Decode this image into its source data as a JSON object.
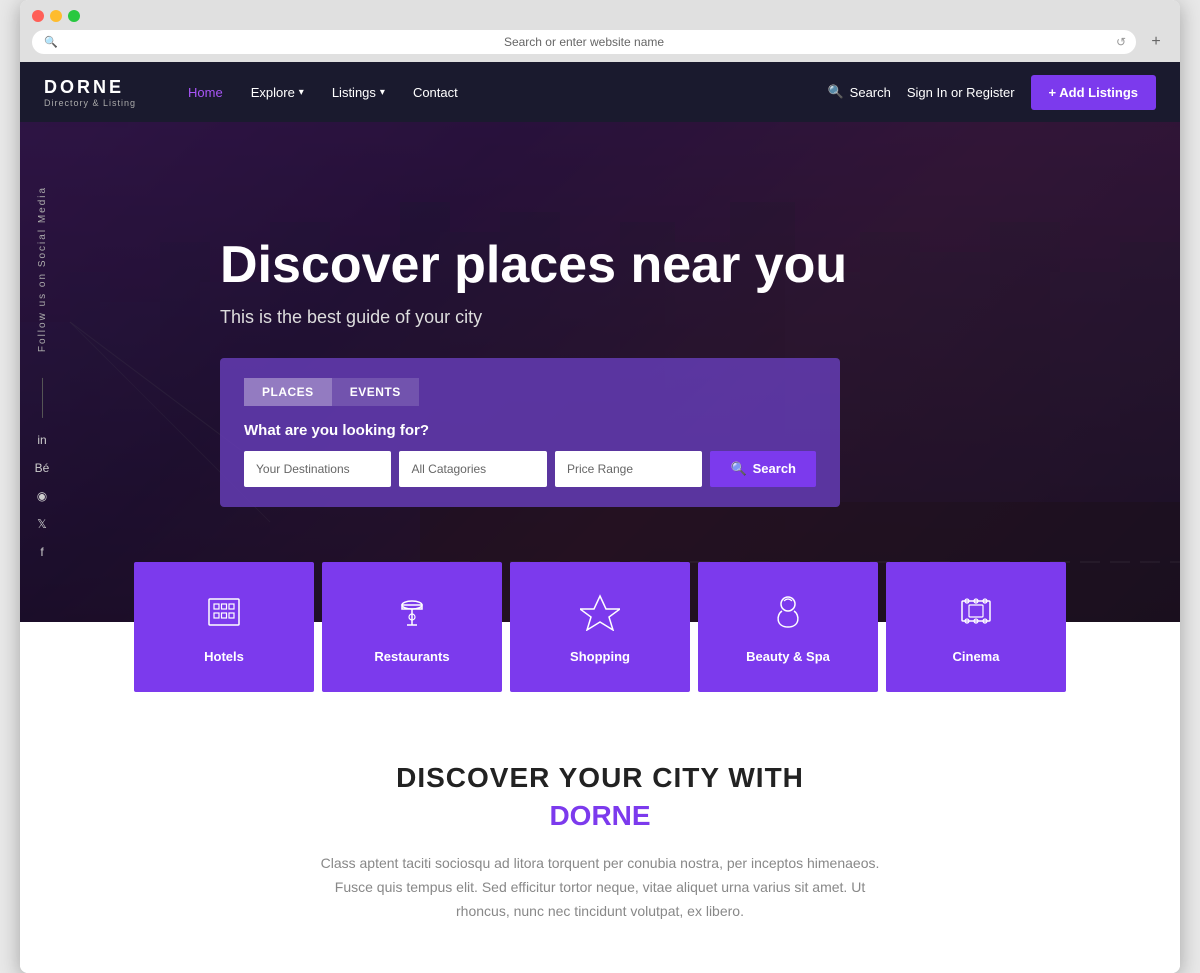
{
  "browser": {
    "address_bar_text": "Search or enter website name",
    "new_tab_label": "+"
  },
  "navbar": {
    "logo_name": "DORNE",
    "logo_subtitle": "Directory & Listing",
    "nav_links": [
      {
        "label": "Home",
        "active": true,
        "has_arrow": false
      },
      {
        "label": "Explore",
        "active": false,
        "has_arrow": true
      },
      {
        "label": "Listings",
        "active": false,
        "has_arrow": true
      },
      {
        "label": "Contact",
        "active": false,
        "has_arrow": false
      }
    ],
    "search_label": "Search",
    "sign_in_label": "Sign In or Register",
    "add_listings_label": "+ Add Listings"
  },
  "hero": {
    "title": "Discover places near you",
    "subtitle": "This is the best guide of your city",
    "search_box": {
      "tabs": [
        {
          "label": "PLACES",
          "active": true
        },
        {
          "label": "EVENTS",
          "active": false
        }
      ],
      "question": "What are you looking for?",
      "destination_placeholder": "Your Destinations",
      "category_placeholder": "All Catagories",
      "price_placeholder": "Price Range",
      "search_button": "Search"
    },
    "social_sidebar": {
      "label": "Follow us on Social Media",
      "icons": [
        "in",
        "Bé",
        "◎",
        "𝕏",
        "f"
      ]
    }
  },
  "categories": [
    {
      "label": "Hotels",
      "icon": "🏨"
    },
    {
      "label": "Restaurants",
      "icon": "🍽️"
    },
    {
      "label": "Shopping",
      "icon": "💎"
    },
    {
      "label": "Beauty & Spa",
      "icon": "💆"
    },
    {
      "label": "Cinema",
      "icon": "🎬"
    }
  ],
  "discover": {
    "title": "DISCOVER YOUR CITY WITH",
    "brand": "DORNE",
    "description": "Class aptent taciti sociosqu ad litora torquent per conubia nostra, per inceptos himenaeos. Fusce quis tempus elit. Sed efficitur tortor neque, vitae aliquet urna varius sit amet. Ut rhoncus, nunc nec tincidunt volutpat, ex libero."
  },
  "colors": {
    "purple": "#7c3aed",
    "dark_nav": "#1a1a2e"
  }
}
